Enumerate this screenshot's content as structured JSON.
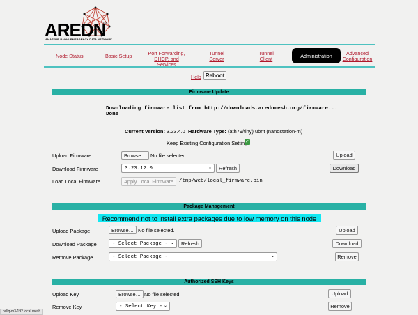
{
  "logo": {
    "title": "AREDN",
    "tm": "TM",
    "subtitle": "AMATEUR RADIO EMERGENCY DATA NETWORK"
  },
  "nav": {
    "node_status": "Node Status",
    "basic_setup": "Basic Setup",
    "port_forwarding_line1": "Port Forwarding,",
    "port_forwarding_line2": "DHCP, and Services",
    "tunnel_server_line1": "Tunnel",
    "tunnel_server_line2": "Server",
    "tunnel_client_line1": "Tunnel",
    "tunnel_client_line2": "Client",
    "administration": "Administration",
    "advanced_line1": "Advanced",
    "advanced_line2": "Configuration"
  },
  "header_actions": {
    "help": "Help",
    "reboot": "Reboot"
  },
  "firmware": {
    "section_title": "Firmware Update",
    "download_msg_line1": "Downloading firmware list from http://downloads.arednmesh.org/firmware...",
    "download_msg_line2": "Done",
    "current_version_label": "Current Version:",
    "current_version": "3.23.4.0",
    "hardware_type_label": "Hardware Type:",
    "hardware_type": "(ath79/tiny) ubnt (nanostation-m)",
    "keep_settings": "Keep Existing Configuration Settings",
    "keep_settings_checked": "✓",
    "upload_label": "Upload Firmware",
    "browse": "Browse…",
    "no_file": "No file selected.",
    "upload_button": "Upload",
    "download_label": "Download Firmware",
    "firmware_select": "3.23.12.0",
    "refresh": "Refresh",
    "download_button": "Download",
    "local_label": "Load Local Firmware",
    "apply_local": "Apply Local Firmware",
    "local_path": "/tmp/web/local_firmware.bin"
  },
  "packages": {
    "section_title": "Package Management",
    "notice": "Recommend not to install extra packages due to low memory on this node",
    "upload_label": "Upload Package",
    "browse": "Browse…",
    "no_file": "No file selected.",
    "upload_button": "Upload",
    "download_label": "Download Package",
    "select_package": "- Select Package -",
    "refresh": "Refresh",
    "download_button": "Download",
    "remove_label": "Remove Package",
    "remove_select": "- Select Package -",
    "remove_button": "Remove"
  },
  "ssh": {
    "section_title": "Authorized SSH Keys",
    "upload_label": "Upload Key",
    "browse": "Browse…",
    "no_file": "No file selected.",
    "upload_button": "Upload",
    "remove_label": "Remove Key",
    "select_key": "- Select Key -",
    "remove_button": "Remove"
  },
  "status_bar": {
    "url": "ncllq-m3-192.local.mesh"
  },
  "colors": {
    "teal": "#29b1a5",
    "link_red": "#b0182b",
    "notice_cyan": "#11e8f2",
    "check_green": "#3b9a42"
  }
}
